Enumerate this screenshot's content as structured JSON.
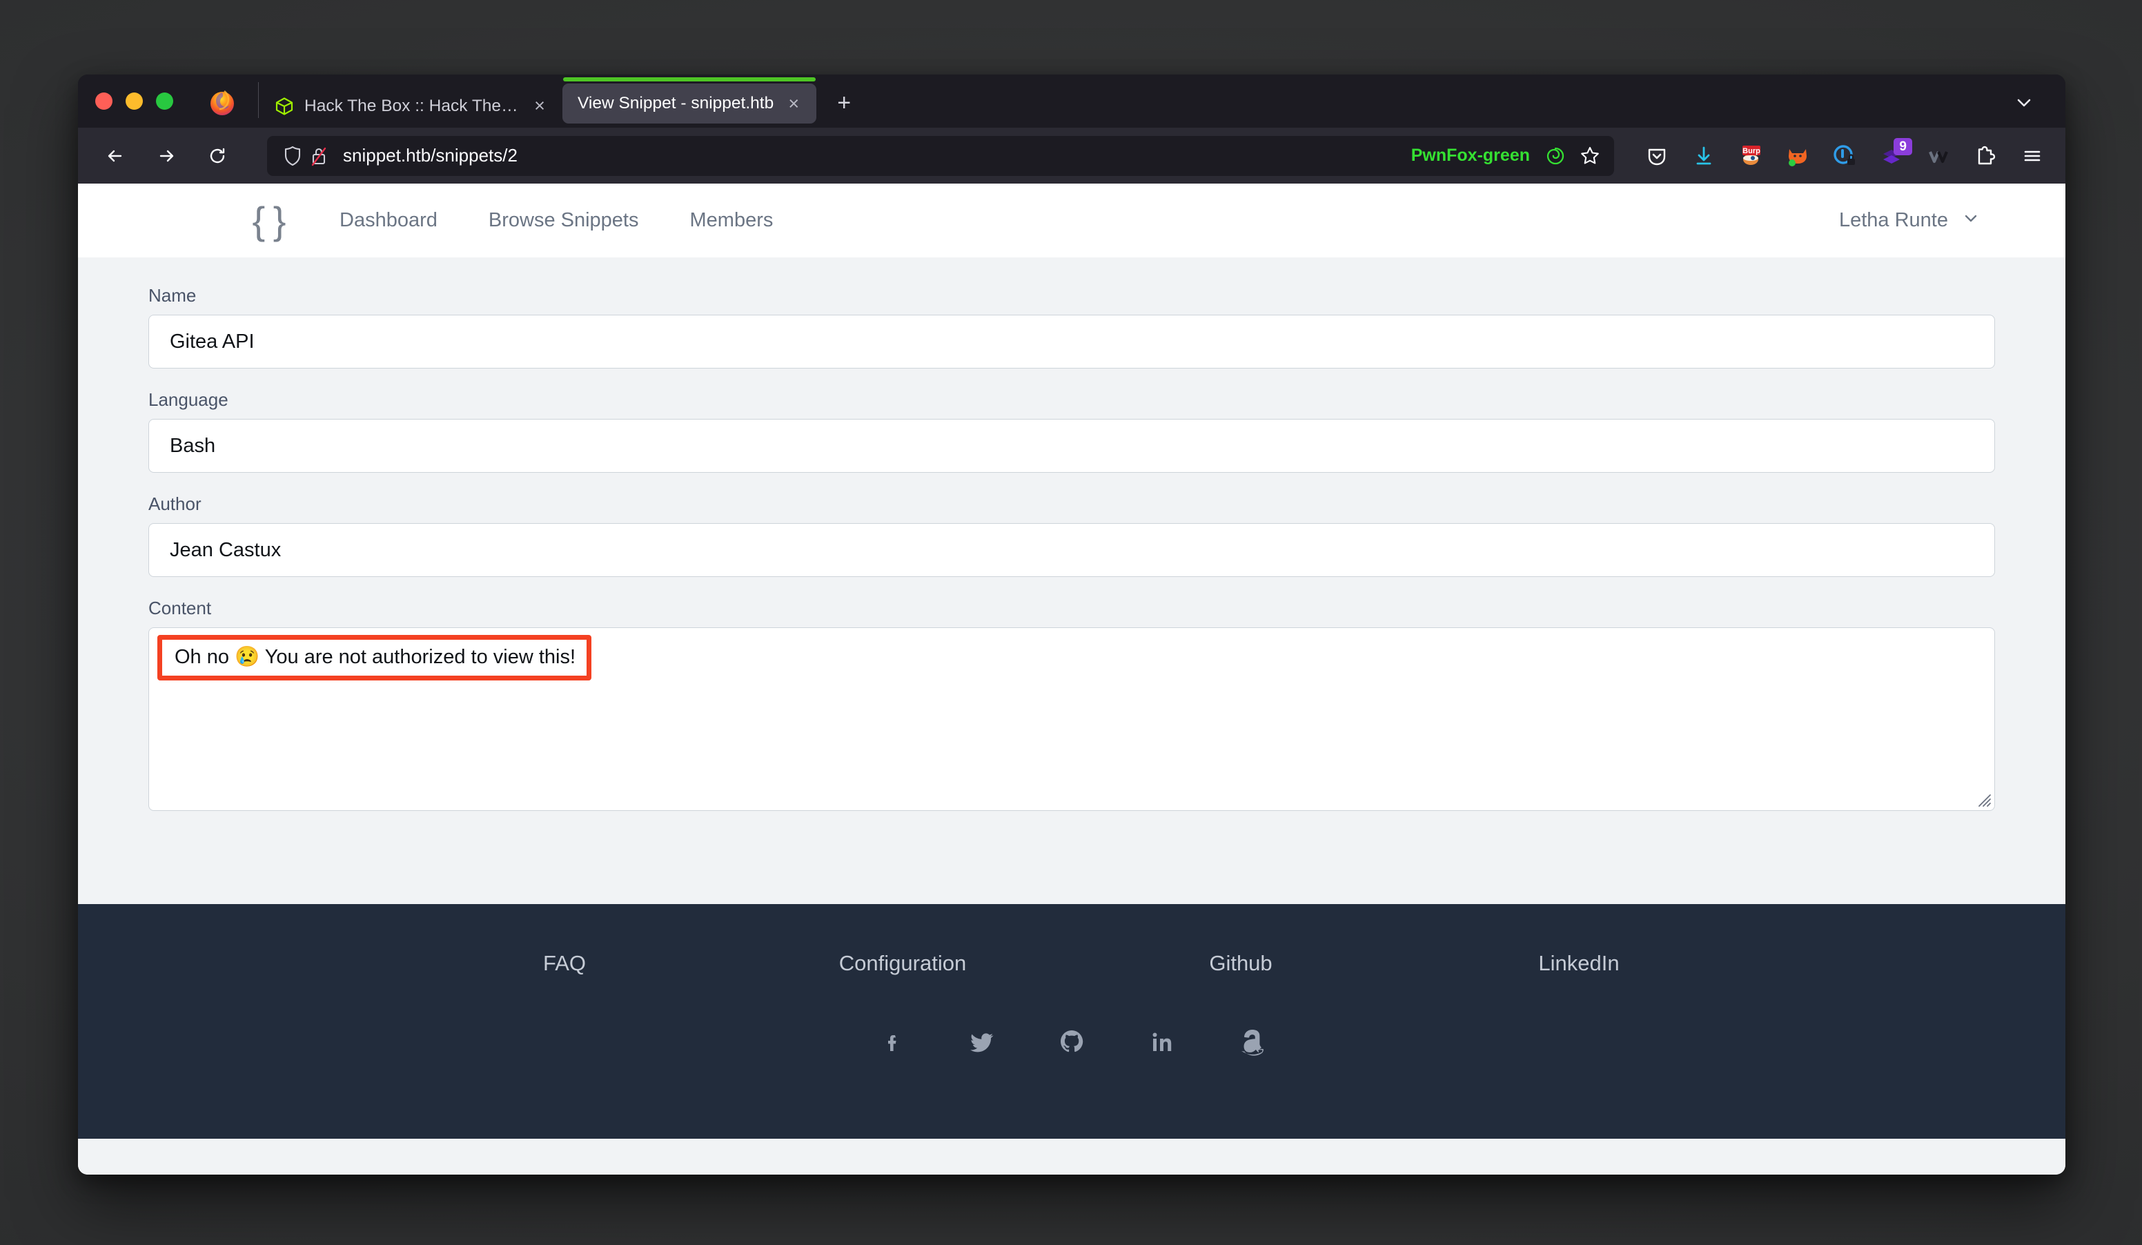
{
  "browser": {
    "window_controls": [
      "close",
      "minimize",
      "maximize"
    ],
    "tabs": [
      {
        "title": "Hack The Box :: Hack The Box",
        "favicon": "htb-cube-icon",
        "active": false,
        "close_label": "×"
      },
      {
        "title": "View Snippet - snippet.htb",
        "favicon": "none",
        "active": true,
        "close_label": "×",
        "container_color": "#4ec525"
      }
    ],
    "new_tab_label": "+",
    "toolbar": {
      "back_label": "←",
      "forward_label": "→",
      "reload_label": "↻",
      "url": "snippet.htb/snippets/2",
      "shield_icon": "tracking-protection-shield-icon",
      "lock_icon": "insecure-lock-icon",
      "container_label": "PwnFox-green",
      "container_color": "#35e032",
      "bookmark_icon": "star-icon"
    },
    "extensions": [
      {
        "name": "pocket-icon",
        "label": ""
      },
      {
        "name": "downloads-icon",
        "label": ""
      },
      {
        "name": "burp-suite-icon",
        "label": "Burp"
      },
      {
        "name": "foxyproxy-icon",
        "label": ""
      },
      {
        "name": "cookie-editor-icon",
        "label": ""
      },
      {
        "name": "layers-icon",
        "label": "",
        "badge": "9"
      },
      {
        "name": "wappalyzer-icon",
        "label": ""
      },
      {
        "name": "extensions-puzzle-icon",
        "label": ""
      },
      {
        "name": "app-menu-icon",
        "label": ""
      }
    ]
  },
  "site": {
    "brand_logo": "{ }",
    "nav_links": [
      {
        "label": "Dashboard"
      },
      {
        "label": "Browse Snippets"
      },
      {
        "label": "Members"
      }
    ],
    "user": {
      "name": "Letha Runte",
      "chevron": "chevron-down-icon"
    }
  },
  "form": {
    "fields": [
      {
        "label": "Name",
        "value": "Gitea API"
      },
      {
        "label": "Language",
        "value": "Bash"
      },
      {
        "label": "Author",
        "value": "Jean Castux"
      }
    ],
    "content": {
      "label": "Content",
      "value": "Oh no 😢 You are not authorized to view this!",
      "annotation_color": "#f44122"
    }
  },
  "footer": {
    "links": [
      {
        "label": "FAQ"
      },
      {
        "label": "Configuration"
      },
      {
        "label": "Github"
      },
      {
        "label": "LinkedIn"
      }
    ],
    "socials": [
      {
        "name": "facebook-icon"
      },
      {
        "name": "twitter-icon"
      },
      {
        "name": "github-icon"
      },
      {
        "name": "linkedin-icon"
      },
      {
        "name": "amazon-icon"
      }
    ]
  },
  "colors": {
    "footer_bg": "#222c3c",
    "page_bg": "#f1f3f5",
    "browser_chrome": "#2b2a33",
    "tabstrip": "#1c1b22",
    "annotation": "#f44122",
    "container_green": "#4ec525"
  }
}
